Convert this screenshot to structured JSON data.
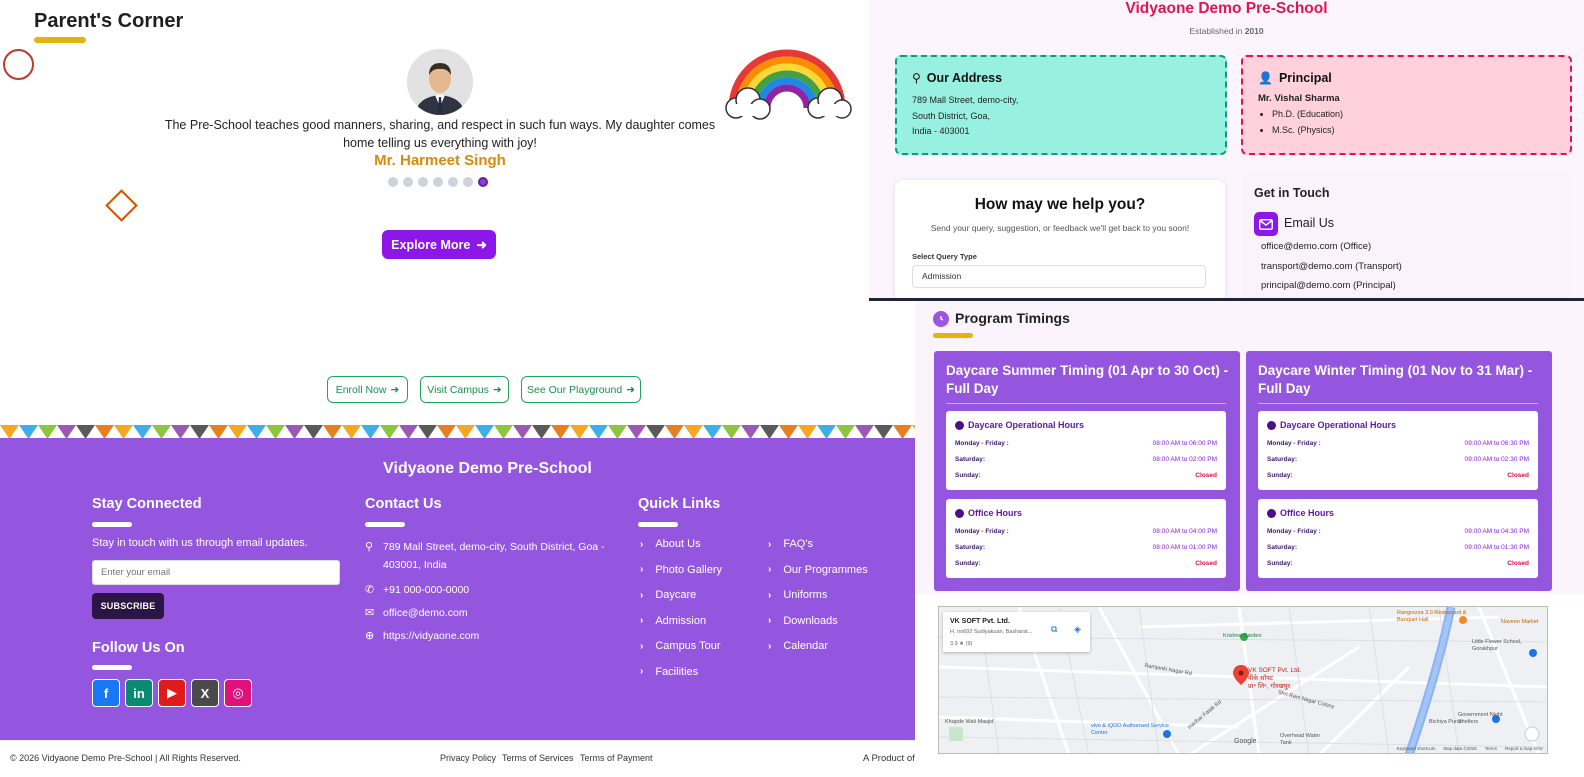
{
  "parents_corner": {
    "title": "Parent's Corner",
    "testimonial": "The Pre-School teaches good manners, sharing, and respect in such fun ways. My daughter comes home telling us everything with joy!",
    "author": "Mr. Harmeet Singh",
    "dots_count": 7,
    "active_dot": 6,
    "explore_label": "Explore More"
  },
  "cta_buttons": [
    "Enroll Now",
    "Visit Campus",
    "See Our Playground"
  ],
  "footer": {
    "school_name": "Vidyaone Demo Pre-School",
    "stay_connected": {
      "title": "Stay Connected",
      "text": "Stay in touch with us through email updates.",
      "email_placeholder": "Enter your email",
      "subscribe_label": "SUBSCRIBE"
    },
    "follow_title": "Follow Us On",
    "socials": [
      {
        "icon": "facebook-icon",
        "glyph": "f",
        "color": "#1877f2"
      },
      {
        "icon": "linkedin-icon",
        "glyph": "in",
        "color": "#0a8a72"
      },
      {
        "icon": "youtube-icon",
        "glyph": "▶",
        "color": "#e01b1b"
      },
      {
        "icon": "x-icon",
        "glyph": "X",
        "color": "#4a4a4a"
      },
      {
        "icon": "instagram-icon",
        "glyph": "◎",
        "color": "#e0117a"
      }
    ],
    "contact": {
      "title": "Contact Us",
      "address": "789 Mall Street, demo-city, South District, Goa - 403001, India",
      "phone": "+91 000-000-0000",
      "email": "office@demo.com",
      "website": "https://vidyaone.com"
    },
    "quick_links": {
      "title": "Quick Links",
      "col1": [
        "About Us",
        "Photo Gallery",
        "Daycare",
        "Admission",
        "Campus Tour",
        "Facilities"
      ],
      "col2": [
        "FAQ's",
        "Our Programmes",
        "Uniforms",
        "Downloads",
        "Calendar"
      ]
    }
  },
  "bottom_bar": {
    "copyright": "© 2026 Vidyaone Demo Pre-School | All Rights Reserved.",
    "links": [
      "Privacy Policy",
      "Terms of Services",
      "Terms of Payment"
    ],
    "product": "A Product of"
  },
  "contact_page": {
    "school_name": "Vidyaone Demo Pre-School",
    "established": "Established in",
    "established_year": "2010",
    "address": {
      "title": "Our Address",
      "lines": [
        "789 Mall Street, demo-city,",
        "South District, Goa,",
        "India - 403001"
      ]
    },
    "principal": {
      "title": "Principal",
      "name": "Mr. Vishal Sharma",
      "qualifications": [
        "Ph.D. (Education)",
        "M.Sc. (Physics)"
      ]
    },
    "help": {
      "title": "How may we help you?",
      "subtitle": "Send your query, suggestion, or feedback we'll get back to you soon!",
      "select_label": "Select Query Type",
      "select_value": "Admission"
    },
    "get_in_touch": {
      "title": "Get in Touch",
      "email_title": "Email Us",
      "emails": [
        {
          "address": "office@demo.com",
          "tag": "(Office)"
        },
        {
          "address": "transport@demo.com",
          "tag": "(Transport)"
        },
        {
          "address": "principal@demo.com",
          "tag": "(Principal)"
        }
      ]
    }
  },
  "program_timings": {
    "title": "Program Timings",
    "cards": [
      {
        "title": "Daycare Summer Timing (01 Apr to 30 Oct) - Full Day",
        "sections": [
          {
            "title": "Daycare Operational Hours",
            "rows": [
              [
                "Monday - Friday :",
                "08:00 AM to 06:00 PM"
              ],
              [
                "Saturday:",
                "08:00 AM to 02:00 PM"
              ],
              [
                "Sunday:",
                "Closed"
              ]
            ]
          },
          {
            "title": "Office Hours",
            "rows": [
              [
                "Monday - Friday :",
                "08:00 AM to 04:00 PM"
              ],
              [
                "Saturday:",
                "08:00 AM to 01:00 PM"
              ],
              [
                "Sunday:",
                "Closed"
              ]
            ]
          }
        ]
      },
      {
        "title": "Daycare Winter Timing (01 Nov to 31 Mar) - Full Day",
        "sections": [
          {
            "title": "Daycare Operational Hours",
            "rows": [
              [
                "Monday - Friday :",
                "09:00 AM to 06:30 PM"
              ],
              [
                "Saturday:",
                "09:00 AM to 02:30 PM"
              ],
              [
                "Sunday:",
                "Closed"
              ]
            ]
          },
          {
            "title": "Office Hours",
            "rows": [
              [
                "Monday - Friday :",
                "09:00 AM to 04:30 PM"
              ],
              [
                "Saturday:",
                "09:00 AM to 01:30 PM"
              ],
              [
                "Sunday:",
                "Closed"
              ]
            ]
          }
        ]
      }
    ]
  },
  "map": {
    "place_name": "VK SOFT Pvt. Ltd.",
    "place_address": "H. no692 Sudiyakuan, Basharat...",
    "rating": "3.9 ★ (9)",
    "pin_label": "VK SOFT Pvt. Ltd.",
    "pin_sub": "वीके सॉफ्ट",
    "pin_sub2": "प्रा॰ लि॰, गोरखपुर",
    "labels": [
      "Rangrezza 3.0 Restaurant & Banquet Hall",
      "Naveen Market",
      "Krishna Garden",
      "Little Flower School, Gorakhpur",
      "Ramjanki Nagar Rd",
      "Shri Ram Nagar Colony",
      "Harihar Fatak Rd",
      "Khapde Wali Masjid",
      "vivo & iQOO Authorised Service Center",
      "Overhead Water Tank",
      "Government Night Shelters",
      "Bichiya Puran",
      "Google"
    ],
    "footer": [
      "Keyboard shortcuts",
      "Map data ©2026",
      "Terms",
      "Report a map error"
    ]
  }
}
